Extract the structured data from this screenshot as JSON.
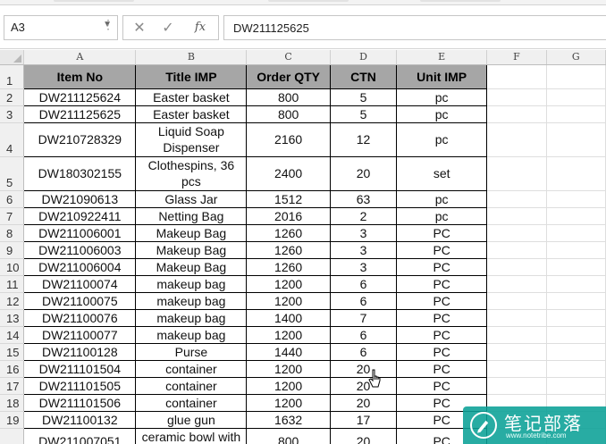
{
  "name_box": {
    "value": "A3"
  },
  "formula_bar": {
    "cancel_glyph": "✕",
    "enter_glyph": "✓",
    "fx_label": "fx",
    "value": "DW211125625"
  },
  "columns": [
    "A",
    "B",
    "C",
    "D",
    "E",
    "F",
    "G"
  ],
  "header_row": {
    "row_number": "1",
    "cells": [
      "Item No",
      "Title IMP",
      "Order QTY",
      "CTN",
      "Unit IMP"
    ]
  },
  "rows": [
    {
      "n": "2",
      "cells": [
        "DW211125624",
        "Easter basket",
        "800",
        "5",
        "pc"
      ]
    },
    {
      "n": "3",
      "cells": [
        "DW211125625",
        "Easter basket",
        "800",
        "5",
        "pc"
      ]
    },
    {
      "n": "4",
      "cells": [
        "DW210728329",
        "Liquid Soap Dispenser",
        "2160",
        "12",
        "pc"
      ]
    },
    {
      "n": "5",
      "cells": [
        "DW180302155",
        "Clothespins, 36 pcs",
        "2400",
        "20",
        "set"
      ]
    },
    {
      "n": "6",
      "cells": [
        "DW21090613",
        "Glass Jar",
        "1512",
        "63",
        "pc"
      ]
    },
    {
      "n": "7",
      "cells": [
        "DW210922411",
        "Netting Bag",
        "2016",
        "2",
        "pc"
      ]
    },
    {
      "n": "8",
      "cells": [
        "DW211006001",
        "Makeup Bag",
        "1260",
        "3",
        "PC"
      ]
    },
    {
      "n": "9",
      "cells": [
        "DW211006003",
        "Makeup Bag",
        "1260",
        "3",
        "PC"
      ]
    },
    {
      "n": "10",
      "cells": [
        "DW211006004",
        "Makeup Bag",
        "1260",
        "3",
        "PC"
      ]
    },
    {
      "n": "11",
      "cells": [
        "DW21100074",
        "makeup bag",
        "1200",
        "6",
        "PC"
      ]
    },
    {
      "n": "12",
      "cells": [
        "DW21100075",
        "makeup bag",
        "1200",
        "6",
        "PC"
      ]
    },
    {
      "n": "13",
      "cells": [
        "DW21100076",
        "makeup bag",
        "1400",
        "7",
        "PC"
      ]
    },
    {
      "n": "14",
      "cells": [
        "DW21100077",
        "makeup bag",
        "1200",
        "6",
        "PC"
      ]
    },
    {
      "n": "15",
      "cells": [
        "DW21100128",
        "Purse",
        "1440",
        "6",
        "PC"
      ]
    },
    {
      "n": "16",
      "cells": [
        "DW211101504",
        "container",
        "1200",
        "20",
        "PC"
      ]
    },
    {
      "n": "17",
      "cells": [
        "DW211101505",
        "container",
        "1200",
        "20",
        "PC"
      ]
    },
    {
      "n": "18",
      "cells": [
        "DW211101506",
        "container",
        "1200",
        "20",
        "PC"
      ]
    },
    {
      "n": "19",
      "cells": [
        "DW21100132",
        "glue gun",
        "1632",
        "17",
        "PC"
      ]
    },
    {
      "n": "20",
      "cells": [
        "DW211007051",
        "ceramic bowl with",
        "800",
        "20",
        "PC"
      ]
    }
  ],
  "watermark": {
    "title": "笔记部落",
    "url": "www.notetribe.com",
    "brand_color": "#0aa096"
  },
  "colors": {
    "header_fill": "#a6a6a6",
    "grid_border": "#000000"
  }
}
